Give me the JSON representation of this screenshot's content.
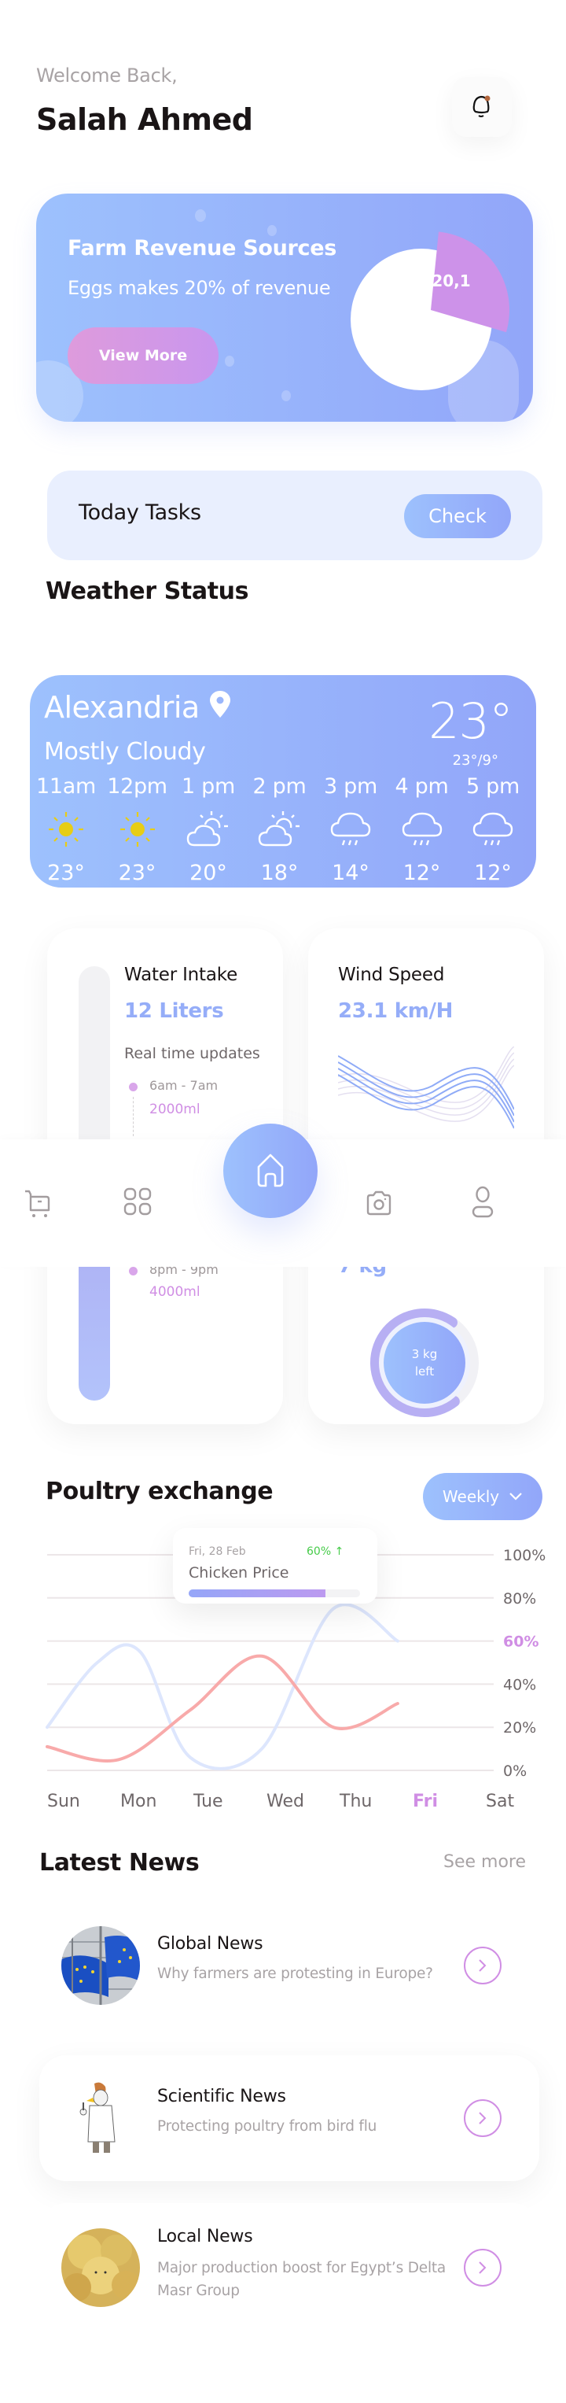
{
  "header": {
    "welcome": "Welcome Back,",
    "user_name": "Salah Ahmed",
    "notification_icon": "bell-icon",
    "has_unread": true
  },
  "revenue": {
    "title": "Farm Revenue Sources",
    "subtitle": "Eggs makes 20% of revenue",
    "button_label": "View More",
    "pie_label": "20,1",
    "highlight_fraction": 0.2
  },
  "tasks": {
    "label": "Today Tasks",
    "button_label": "Check"
  },
  "weather": {
    "section_title": "Weather Status",
    "city": "Alexandria",
    "location_icon": "map-pin-icon",
    "condition": "Mostly Cloudy",
    "current_temp": "23°",
    "range": "23°/9°",
    "hours": [
      {
        "time": "11am",
        "icon": "sun-icon",
        "temp": "23°"
      },
      {
        "time": "12pm",
        "icon": "sun-icon",
        "temp": "23°"
      },
      {
        "time": "1 pm",
        "icon": "partly-cloudy-icon",
        "temp": "20°"
      },
      {
        "time": "2 pm",
        "icon": "partly-cloudy-icon",
        "temp": "18°"
      },
      {
        "time": "3 pm",
        "icon": "rain-icon",
        "temp": "14°"
      },
      {
        "time": "4 pm",
        "icon": "rain-icon",
        "temp": "12°"
      },
      {
        "time": "5 pm",
        "icon": "rain-icon",
        "temp": "12°"
      }
    ]
  },
  "water": {
    "title": "Water Intake",
    "value": "12 Liters",
    "updates_label": "Real time updates",
    "fill_fraction": 0.35,
    "timeline": [
      {
        "range": "6am - 7am",
        "amount": "2000ml"
      },
      {
        "range": "8pm - 9pm",
        "amount": "4000ml"
      }
    ]
  },
  "wind": {
    "title": "Wind Speed",
    "value": "23.1 km/H"
  },
  "feed": {
    "value": "7 kg",
    "gauge_line1": "3 kg",
    "gauge_line2": "left",
    "progress_fraction": 0.7
  },
  "nav": {
    "items": [
      {
        "icon": "cart-icon"
      },
      {
        "icon": "grid-icon"
      },
      {
        "icon": "home-icon",
        "active": true
      },
      {
        "icon": "camera-icon"
      },
      {
        "icon": "profile-icon"
      }
    ]
  },
  "poultry": {
    "title": "Poultry exchange",
    "period_label": "Weekly",
    "tooltip": {
      "date": "Fri, 28 Feb",
      "change": "60% ↑",
      "title": "Chicken Price",
      "progress_fraction": 0.8
    }
  },
  "chart_data": {
    "type": "line",
    "title": "Poultry exchange",
    "categories": [
      "Sun",
      "Mon",
      "Tue",
      "Wed",
      "Thu",
      "Fri",
      "Sat"
    ],
    "highlight_category": "Fri",
    "highlight_value_label": "60%",
    "y_ticks": [
      "0%",
      "20%",
      "40%",
      "60%",
      "80%",
      "100%"
    ],
    "ylim": [
      0,
      100
    ],
    "grid": true,
    "series": [
      {
        "name": "blue",
        "color": "#dde6fd",
        "x": [
          0,
          0.7,
          1.3,
          2.0,
          3.0,
          4.0,
          4.9
        ],
        "values": [
          20,
          50,
          55,
          6,
          10,
          75,
          60
        ]
      },
      {
        "name": "red",
        "color": "#f8aaaa",
        "x": [
          0,
          1.0,
          2.0,
          3.0,
          4.0,
          4.9
        ],
        "values": [
          11,
          5,
          28,
          53,
          20,
          31
        ]
      }
    ],
    "colors": {
      "accent": "#d08ee4",
      "axis_text": "#6e6769",
      "grid": "#ece6e8"
    }
  },
  "news": {
    "title": "Latest News",
    "see_more": "See more",
    "items": [
      {
        "title": "Global News",
        "description": "Why farmers are protesting in Europe?",
        "thumb": "eu-flags-image"
      },
      {
        "title": "Scientific News",
        "description": "Protecting poultry from bird flu",
        "thumb": "doctor-rooster-image"
      },
      {
        "title": "Local News",
        "description": "Major production boost for Egypt’s Delta Masr Group",
        "thumb": "chicks-image"
      }
    ]
  }
}
